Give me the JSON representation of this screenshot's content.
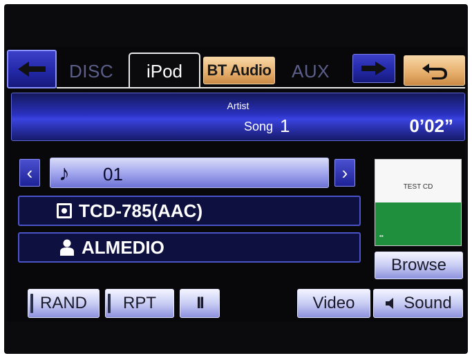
{
  "tabs": {
    "back_icon": "left-arrow-icon",
    "items": [
      {
        "label": "DISC"
      },
      {
        "label": "iPod",
        "active": true
      },
      {
        "label": "BT Audio"
      },
      {
        "label": "AUX"
      }
    ],
    "forward_icon": "right-arrow-icon",
    "return_icon": "return-icon"
  },
  "now_playing": {
    "artist_label": "Artist",
    "song_label": "Song",
    "song_number": "1",
    "elapsed_time": "0’02”"
  },
  "track": {
    "number": "01",
    "note_icon": "music-note-icon"
  },
  "album": {
    "name": "TCD-785(AAC)",
    "icon": "disc-icon"
  },
  "artist": {
    "name": "ALMEDIO",
    "icon": "person-icon"
  },
  "album_art": {
    "title": "TEST CD"
  },
  "controls": {
    "browse": "Browse",
    "rand": "RAND",
    "rpt": "RPT",
    "pause": "II",
    "video": "Video",
    "sound": "Sound",
    "sound_icon": "speaker-icon"
  },
  "colors": {
    "accent_blue": "#2a31c0",
    "tab_orange": "#e6ad6a",
    "art_green": "#1f8f3e"
  }
}
